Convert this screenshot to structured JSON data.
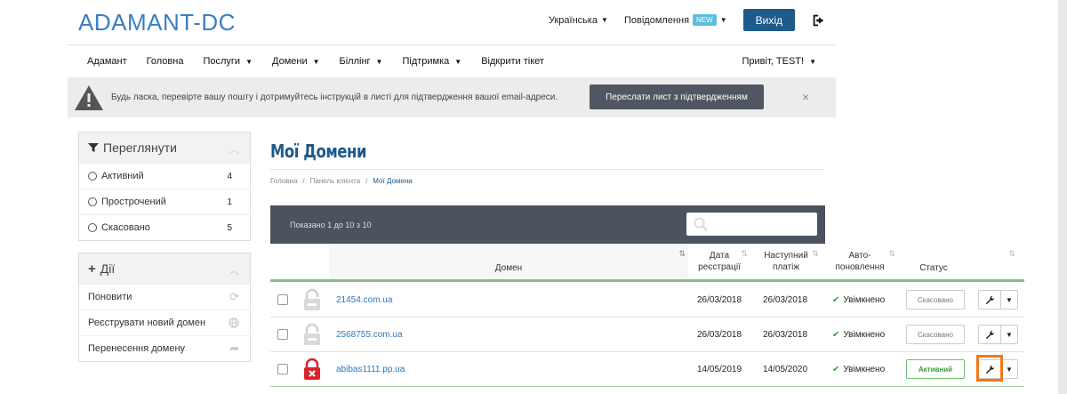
{
  "header": {
    "logo": "ADAMANT-DC",
    "language": "Українська",
    "notifications": "Повідомлення",
    "notifications_badge": "NEW",
    "exit": "Вихід"
  },
  "nav": {
    "items": [
      "Адамант",
      "Головна",
      "Послуги",
      "Домени",
      "Біллінг",
      "Підтримка",
      "Відкрити тікет"
    ],
    "greeting": "Привіт, TEST!"
  },
  "alert": {
    "text": "Будь ласка, перевірте вашу пошту і дотримуйтесь інструкцій в листі для підтвердження вашої email-адреси.",
    "button": "Переслати лист з підтвердженням",
    "close": "×"
  },
  "sidebar": {
    "filter": {
      "title": "Переглянути",
      "items": [
        {
          "label": "Активний",
          "count": "4"
        },
        {
          "label": "Прострочений",
          "count": "1"
        },
        {
          "label": "Скасовано",
          "count": "5"
        }
      ]
    },
    "actions": {
      "title": "Дії",
      "items": [
        {
          "label": "Поновити",
          "icon": "refresh-icon"
        },
        {
          "label": "Реєструвати новий домен",
          "icon": "globe-icon"
        },
        {
          "label": "Перенесення домену",
          "icon": "share-arrow-icon"
        }
      ]
    }
  },
  "main": {
    "title": "Мої Домени",
    "breadcrumb": [
      "Головна",
      "Панель клієнта",
      "Мої Домени"
    ],
    "showing": "Показано 1 до 10 з 10",
    "columns": {
      "domain": "Домен",
      "reg_date": "Дата реєстрації",
      "next_payment": "Наступний платіж",
      "auto_renew": "Авто-поновлення",
      "status": "Статус"
    },
    "rows": [
      {
        "domain": "21454.com.ua",
        "reg": "26/03/2018",
        "next": "26/03/2018",
        "auto": "Увімкнено",
        "status": "Скасовано",
        "lock": "unlocked"
      },
      {
        "domain": "2568755.com.ua",
        "reg": "26/03/2018",
        "next": "26/03/2018",
        "auto": "Увімкнено",
        "status": "Скасовано",
        "lock": "unlocked"
      },
      {
        "domain": "abibas1111.pp.ua",
        "reg": "14/05/2019",
        "next": "14/05/2020",
        "auto": "Увімкнено",
        "status": "Активний",
        "lock": "locked-red"
      }
    ]
  },
  "colors": {
    "brand": "#1e5a8a",
    "link": "#2c78bf",
    "success": "#3a9b3a",
    "highlight": "#f07818"
  }
}
